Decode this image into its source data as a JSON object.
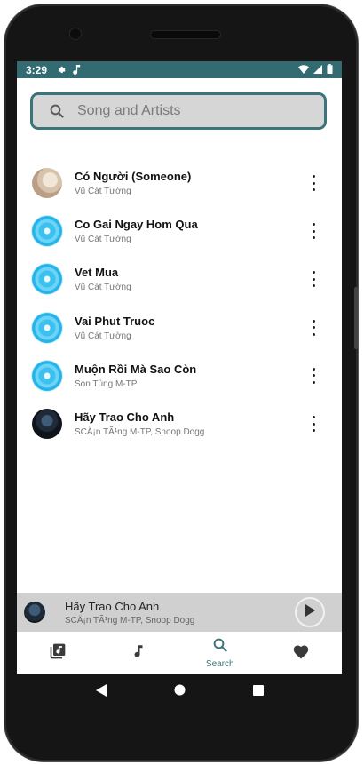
{
  "status": {
    "time": "3:29"
  },
  "search": {
    "placeholder": "Song and Artists"
  },
  "songs": [
    {
      "title": "Có Người (Someone)",
      "artist": "Vũ Cát Tường",
      "art": "photo1"
    },
    {
      "title": "Co Gai Ngay Hom Qua",
      "artist": "Vũ Cát Tường",
      "art": "disc"
    },
    {
      "title": "Vet Mua",
      "artist": "Vũ Cát Tường",
      "art": "disc"
    },
    {
      "title": "Vai Phut Truoc",
      "artist": "Vũ Cát Tường",
      "art": "disc"
    },
    {
      "title": "Muộn Rồi Mà Sao Còn",
      "artist": "Son Tùng M-TP",
      "art": "disc"
    },
    {
      "title": "Hãy Trao Cho Anh",
      "artist": "SCÄ¡n TÃ¹ng M-TP, Snoop Dogg",
      "art": "photo2"
    }
  ],
  "now_playing": {
    "title": "Hãy Trao Cho Anh",
    "artist": "SCÄ¡n TÃ¹ng M-TP, Snoop Dogg"
  },
  "nav": {
    "search_label": "Search",
    "active": "search"
  },
  "colors": {
    "accent": "#3c747a",
    "statusbar": "#326b72",
    "miniplayer": "#d0d0d0"
  },
  "icons": [
    "settings-icon",
    "music-note-icon",
    "wifi-icon",
    "signal-icon",
    "battery-icon",
    "search-icon",
    "more-vert-icon",
    "play-icon",
    "library-icon",
    "heart-icon",
    "back-icon",
    "home-icon",
    "recents-icon"
  ]
}
